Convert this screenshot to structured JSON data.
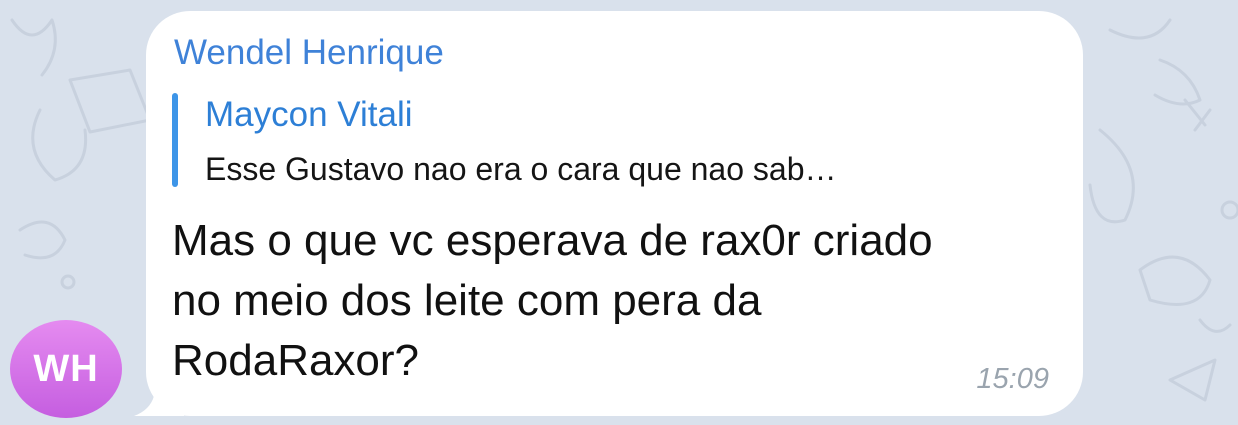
{
  "avatar": {
    "initials": "WH",
    "color": "#d36fe8"
  },
  "message": {
    "sender": "Wendel Henrique",
    "reply": {
      "author": "Maycon Vitali",
      "preview": "Esse Gustavo nao era o cara que nao sab…"
    },
    "text_lines": [
      "Mas o que vc esperava de rax0r criado",
      "no meio dos leite com pera da",
      "RodaRaxor?"
    ],
    "time": "15:09"
  },
  "colors": {
    "background": "#d9e1ec",
    "bubble": "#ffffff",
    "sender_name": "#3f82d8",
    "reply_accent": "#3d95e8",
    "timestamp": "#9aa4ae"
  }
}
